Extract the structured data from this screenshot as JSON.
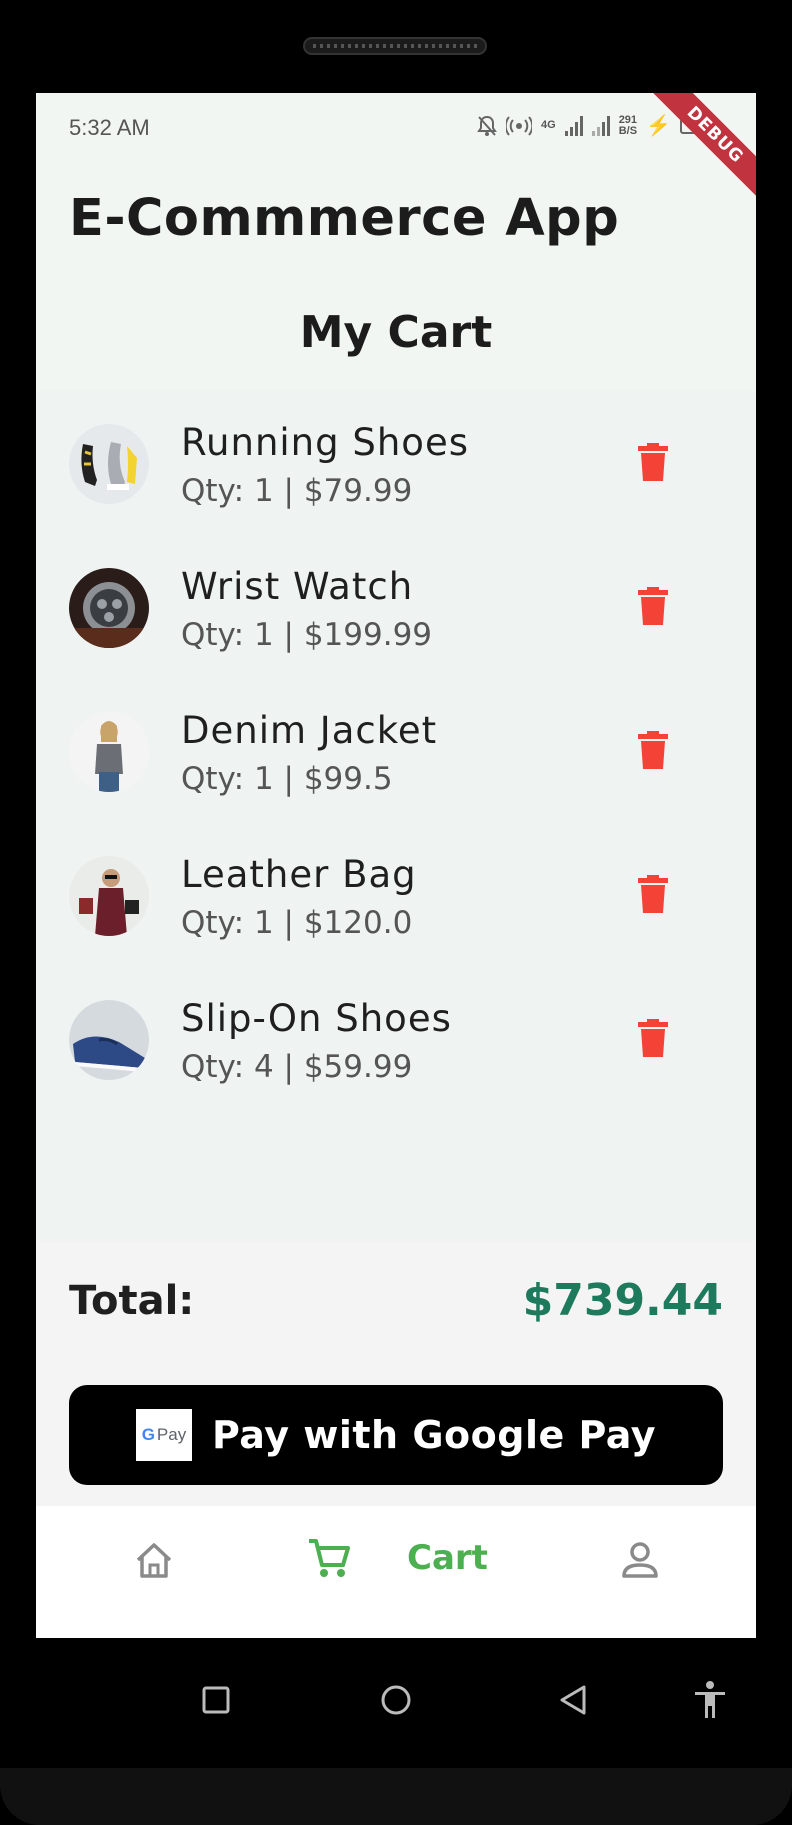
{
  "status_bar": {
    "time": "5:32 AM",
    "network_type": "4G",
    "speed_value": "291",
    "speed_unit": "B/S"
  },
  "debug_banner": "DEBUG",
  "app_title": "E-Commmerce App",
  "page_title": "My Cart",
  "cart_items": [
    {
      "name": "Running Shoes",
      "meta": "Qty: 1  |  $79.99",
      "image": "running-shoes-image"
    },
    {
      "name": "Wrist Watch",
      "meta": "Qty: 1  |  $199.99",
      "image": "wrist-watch-image"
    },
    {
      "name": "Denim Jacket",
      "meta": "Qty: 1  |  $99.5",
      "image": "denim-jacket-image"
    },
    {
      "name": "Leather Bag",
      "meta": "Qty: 1  |  $120.0",
      "image": "leather-bag-image"
    },
    {
      "name": "Slip-On Shoes",
      "meta": "Qty: 4  |  $59.99",
      "image": "slip-on-shoes-image"
    }
  ],
  "total": {
    "label": "Total:",
    "value": "$739.44"
  },
  "pay_button": {
    "label": "Pay with Google Pay",
    "logo_g": "G",
    "logo_pay": "Pay"
  },
  "bottom_nav": {
    "active_label": "Cart",
    "items": [
      "home-icon",
      "cart-icon",
      "person-icon"
    ]
  },
  "colors": {
    "accent_green": "#4caf50",
    "total_green": "#1e7a5c",
    "delete_red": "#f44336",
    "pay_button": "#000000"
  }
}
